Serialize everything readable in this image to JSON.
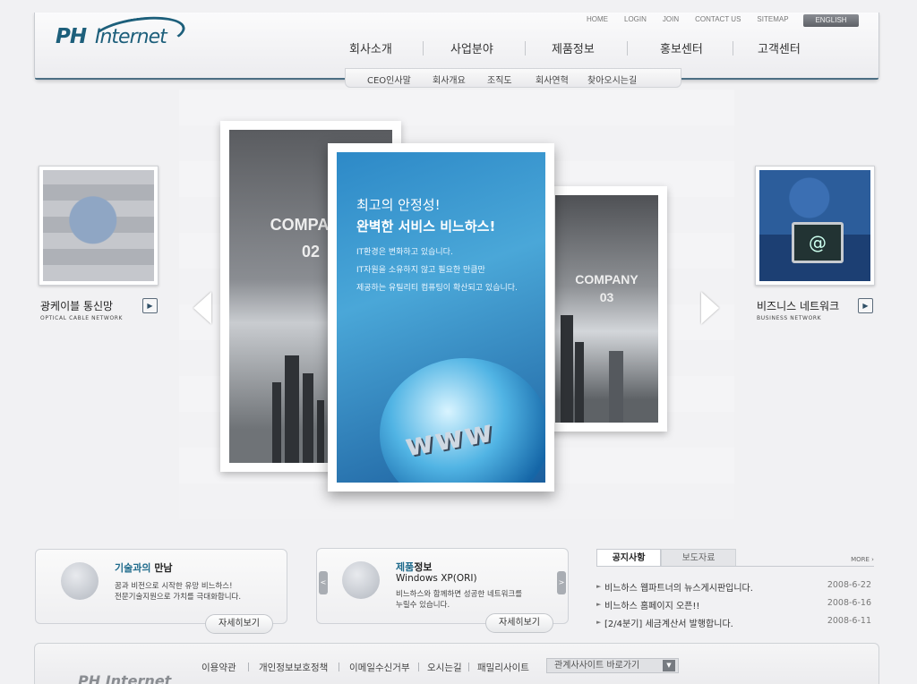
{
  "header": {
    "logo_ph": "PH",
    "logo_internet": "Internet",
    "util_links": [
      "HOME",
      "LOGIN",
      "JOIN",
      "CONTACT US",
      "SITEMAP"
    ],
    "english_button": "ENGLISH"
  },
  "gnb": [
    "회사소개",
    "사업분야",
    "제품정보",
    "홍보센터",
    "고객센터"
  ],
  "subnav": [
    "CEO인사말",
    "회사개요",
    "조직도",
    "회사연혁",
    "찾아오시는길"
  ],
  "left_feature": {
    "title": "광케이블 통신망",
    "subtitle": "OPTICAL CABLE NETWORK"
  },
  "right_feature": {
    "title": "비즈니스 네트워크",
    "subtitle": "BUSINESS NETWORK",
    "monitor_glyph": "@"
  },
  "cards": {
    "back_left": {
      "label": "COMPANY",
      "number": "02"
    },
    "back_right": {
      "label": "COMPANY",
      "number": "03"
    },
    "main": {
      "headline_1": "최고의 안정성!",
      "headline_2": "완벽한 서비스 비느하스!",
      "body": [
        "IT환경은 변화하고 있습니다.",
        "IT자원을 소유하지 않고 필요한 만큼만",
        "제공하는 유틸리티 컴퓨팅이 확산되고 있습니다."
      ],
      "graphic_text": "www"
    }
  },
  "box_tech": {
    "title_accent": "기술과의",
    "title_rest": " 만남",
    "desc": [
      "꿈과 비전으로 시작한 유망 비느하스!",
      "전문기술지원으로 가치를 극대화합니다."
    ],
    "button": "자세히보기"
  },
  "box_product": {
    "title_accent": "제품",
    "title_rest": "정보",
    "product": "Windows XP(ORI)",
    "desc": [
      "비느하스와 함께하면 성공한 네트워크를",
      "누릴수 있습니다."
    ],
    "button": "자세히보기",
    "prev": "<",
    "next": ">"
  },
  "notice": {
    "tabs": [
      "공지사항",
      "보도자료"
    ],
    "more": "MORE ›",
    "items": [
      {
        "title": "비느하스 웹파트너의 뉴스게시판입니다.",
        "date": "2008-6-22"
      },
      {
        "title": "비느하스 홈페이지 오픈!!",
        "date": "2008-6-16"
      },
      {
        "title": "[2/4분기] 세금계산서 발행합니다.",
        "date": "2008-6-11"
      }
    ]
  },
  "footer": {
    "logo": "PH Internet",
    "links": [
      "이용약관",
      "개인정보보호정책",
      "이메일수신거부",
      "오시는길",
      "패밀리사이트"
    ],
    "select": "관계사사이트 바로가기"
  },
  "colors": {
    "brand": "#1d5f7b",
    "accent": "#1f6b8c",
    "card_blue": "#2d89c7"
  }
}
